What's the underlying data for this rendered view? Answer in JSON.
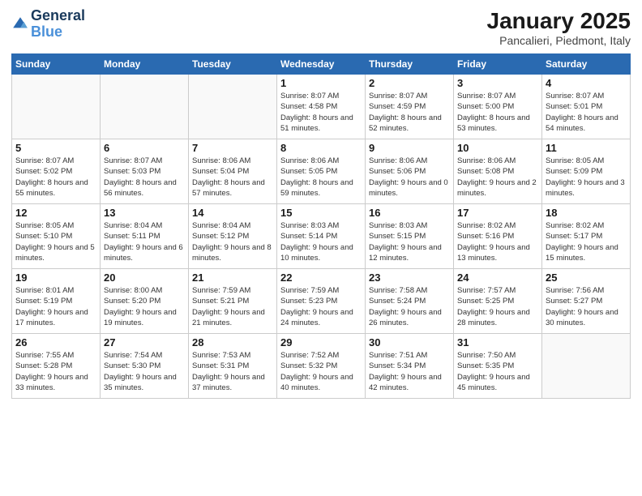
{
  "header": {
    "logo_line1": "General",
    "logo_line2": "Blue",
    "month": "January 2025",
    "location": "Pancalieri, Piedmont, Italy"
  },
  "weekdays": [
    "Sunday",
    "Monday",
    "Tuesday",
    "Wednesday",
    "Thursday",
    "Friday",
    "Saturday"
  ],
  "weeks": [
    [
      {
        "day": "",
        "info": ""
      },
      {
        "day": "",
        "info": ""
      },
      {
        "day": "",
        "info": ""
      },
      {
        "day": "1",
        "info": "Sunrise: 8:07 AM\nSunset: 4:58 PM\nDaylight: 8 hours\nand 51 minutes."
      },
      {
        "day": "2",
        "info": "Sunrise: 8:07 AM\nSunset: 4:59 PM\nDaylight: 8 hours\nand 52 minutes."
      },
      {
        "day": "3",
        "info": "Sunrise: 8:07 AM\nSunset: 5:00 PM\nDaylight: 8 hours\nand 53 minutes."
      },
      {
        "day": "4",
        "info": "Sunrise: 8:07 AM\nSunset: 5:01 PM\nDaylight: 8 hours\nand 54 minutes."
      }
    ],
    [
      {
        "day": "5",
        "info": "Sunrise: 8:07 AM\nSunset: 5:02 PM\nDaylight: 8 hours\nand 55 minutes."
      },
      {
        "day": "6",
        "info": "Sunrise: 8:07 AM\nSunset: 5:03 PM\nDaylight: 8 hours\nand 56 minutes."
      },
      {
        "day": "7",
        "info": "Sunrise: 8:06 AM\nSunset: 5:04 PM\nDaylight: 8 hours\nand 57 minutes."
      },
      {
        "day": "8",
        "info": "Sunrise: 8:06 AM\nSunset: 5:05 PM\nDaylight: 8 hours\nand 59 minutes."
      },
      {
        "day": "9",
        "info": "Sunrise: 8:06 AM\nSunset: 5:06 PM\nDaylight: 9 hours\nand 0 minutes."
      },
      {
        "day": "10",
        "info": "Sunrise: 8:06 AM\nSunset: 5:08 PM\nDaylight: 9 hours\nand 2 minutes."
      },
      {
        "day": "11",
        "info": "Sunrise: 8:05 AM\nSunset: 5:09 PM\nDaylight: 9 hours\nand 3 minutes."
      }
    ],
    [
      {
        "day": "12",
        "info": "Sunrise: 8:05 AM\nSunset: 5:10 PM\nDaylight: 9 hours\nand 5 minutes."
      },
      {
        "day": "13",
        "info": "Sunrise: 8:04 AM\nSunset: 5:11 PM\nDaylight: 9 hours\nand 6 minutes."
      },
      {
        "day": "14",
        "info": "Sunrise: 8:04 AM\nSunset: 5:12 PM\nDaylight: 9 hours\nand 8 minutes."
      },
      {
        "day": "15",
        "info": "Sunrise: 8:03 AM\nSunset: 5:14 PM\nDaylight: 9 hours\nand 10 minutes."
      },
      {
        "day": "16",
        "info": "Sunrise: 8:03 AM\nSunset: 5:15 PM\nDaylight: 9 hours\nand 12 minutes."
      },
      {
        "day": "17",
        "info": "Sunrise: 8:02 AM\nSunset: 5:16 PM\nDaylight: 9 hours\nand 13 minutes."
      },
      {
        "day": "18",
        "info": "Sunrise: 8:02 AM\nSunset: 5:17 PM\nDaylight: 9 hours\nand 15 minutes."
      }
    ],
    [
      {
        "day": "19",
        "info": "Sunrise: 8:01 AM\nSunset: 5:19 PM\nDaylight: 9 hours\nand 17 minutes."
      },
      {
        "day": "20",
        "info": "Sunrise: 8:00 AM\nSunset: 5:20 PM\nDaylight: 9 hours\nand 19 minutes."
      },
      {
        "day": "21",
        "info": "Sunrise: 7:59 AM\nSunset: 5:21 PM\nDaylight: 9 hours\nand 21 minutes."
      },
      {
        "day": "22",
        "info": "Sunrise: 7:59 AM\nSunset: 5:23 PM\nDaylight: 9 hours\nand 24 minutes."
      },
      {
        "day": "23",
        "info": "Sunrise: 7:58 AM\nSunset: 5:24 PM\nDaylight: 9 hours\nand 26 minutes."
      },
      {
        "day": "24",
        "info": "Sunrise: 7:57 AM\nSunset: 5:25 PM\nDaylight: 9 hours\nand 28 minutes."
      },
      {
        "day": "25",
        "info": "Sunrise: 7:56 AM\nSunset: 5:27 PM\nDaylight: 9 hours\nand 30 minutes."
      }
    ],
    [
      {
        "day": "26",
        "info": "Sunrise: 7:55 AM\nSunset: 5:28 PM\nDaylight: 9 hours\nand 33 minutes."
      },
      {
        "day": "27",
        "info": "Sunrise: 7:54 AM\nSunset: 5:30 PM\nDaylight: 9 hours\nand 35 minutes."
      },
      {
        "day": "28",
        "info": "Sunrise: 7:53 AM\nSunset: 5:31 PM\nDaylight: 9 hours\nand 37 minutes."
      },
      {
        "day": "29",
        "info": "Sunrise: 7:52 AM\nSunset: 5:32 PM\nDaylight: 9 hours\nand 40 minutes."
      },
      {
        "day": "30",
        "info": "Sunrise: 7:51 AM\nSunset: 5:34 PM\nDaylight: 9 hours\nand 42 minutes."
      },
      {
        "day": "31",
        "info": "Sunrise: 7:50 AM\nSunset: 5:35 PM\nDaylight: 9 hours\nand 45 minutes."
      },
      {
        "day": "",
        "info": ""
      }
    ]
  ]
}
